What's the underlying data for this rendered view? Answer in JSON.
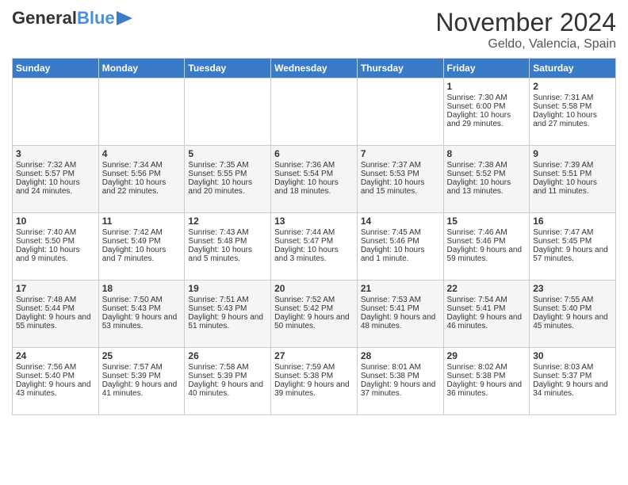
{
  "header": {
    "logo_line1": "General",
    "logo_line2": "Blue",
    "month_title": "November 2024",
    "location": "Geldo, Valencia, Spain"
  },
  "weekdays": [
    "Sunday",
    "Monday",
    "Tuesday",
    "Wednesday",
    "Thursday",
    "Friday",
    "Saturday"
  ],
  "weeks": [
    [
      {
        "day": "",
        "sunrise": "",
        "sunset": "",
        "daylight": ""
      },
      {
        "day": "",
        "sunrise": "",
        "sunset": "",
        "daylight": ""
      },
      {
        "day": "",
        "sunrise": "",
        "sunset": "",
        "daylight": ""
      },
      {
        "day": "",
        "sunrise": "",
        "sunset": "",
        "daylight": ""
      },
      {
        "day": "",
        "sunrise": "",
        "sunset": "",
        "daylight": ""
      },
      {
        "day": "1",
        "sunrise": "Sunrise: 7:30 AM",
        "sunset": "Sunset: 6:00 PM",
        "daylight": "Daylight: 10 hours and 29 minutes."
      },
      {
        "day": "2",
        "sunrise": "Sunrise: 7:31 AM",
        "sunset": "Sunset: 5:58 PM",
        "daylight": "Daylight: 10 hours and 27 minutes."
      }
    ],
    [
      {
        "day": "3",
        "sunrise": "Sunrise: 7:32 AM",
        "sunset": "Sunset: 5:57 PM",
        "daylight": "Daylight: 10 hours and 24 minutes."
      },
      {
        "day": "4",
        "sunrise": "Sunrise: 7:34 AM",
        "sunset": "Sunset: 5:56 PM",
        "daylight": "Daylight: 10 hours and 22 minutes."
      },
      {
        "day": "5",
        "sunrise": "Sunrise: 7:35 AM",
        "sunset": "Sunset: 5:55 PM",
        "daylight": "Daylight: 10 hours and 20 minutes."
      },
      {
        "day": "6",
        "sunrise": "Sunrise: 7:36 AM",
        "sunset": "Sunset: 5:54 PM",
        "daylight": "Daylight: 10 hours and 18 minutes."
      },
      {
        "day": "7",
        "sunrise": "Sunrise: 7:37 AM",
        "sunset": "Sunset: 5:53 PM",
        "daylight": "Daylight: 10 hours and 15 minutes."
      },
      {
        "day": "8",
        "sunrise": "Sunrise: 7:38 AM",
        "sunset": "Sunset: 5:52 PM",
        "daylight": "Daylight: 10 hours and 13 minutes."
      },
      {
        "day": "9",
        "sunrise": "Sunrise: 7:39 AM",
        "sunset": "Sunset: 5:51 PM",
        "daylight": "Daylight: 10 hours and 11 minutes."
      }
    ],
    [
      {
        "day": "10",
        "sunrise": "Sunrise: 7:40 AM",
        "sunset": "Sunset: 5:50 PM",
        "daylight": "Daylight: 10 hours and 9 minutes."
      },
      {
        "day": "11",
        "sunrise": "Sunrise: 7:42 AM",
        "sunset": "Sunset: 5:49 PM",
        "daylight": "Daylight: 10 hours and 7 minutes."
      },
      {
        "day": "12",
        "sunrise": "Sunrise: 7:43 AM",
        "sunset": "Sunset: 5:48 PM",
        "daylight": "Daylight: 10 hours and 5 minutes."
      },
      {
        "day": "13",
        "sunrise": "Sunrise: 7:44 AM",
        "sunset": "Sunset: 5:47 PM",
        "daylight": "Daylight: 10 hours and 3 minutes."
      },
      {
        "day": "14",
        "sunrise": "Sunrise: 7:45 AM",
        "sunset": "Sunset: 5:46 PM",
        "daylight": "Daylight: 10 hours and 1 minute."
      },
      {
        "day": "15",
        "sunrise": "Sunrise: 7:46 AM",
        "sunset": "Sunset: 5:46 PM",
        "daylight": "Daylight: 9 hours and 59 minutes."
      },
      {
        "day": "16",
        "sunrise": "Sunrise: 7:47 AM",
        "sunset": "Sunset: 5:45 PM",
        "daylight": "Daylight: 9 hours and 57 minutes."
      }
    ],
    [
      {
        "day": "17",
        "sunrise": "Sunrise: 7:48 AM",
        "sunset": "Sunset: 5:44 PM",
        "daylight": "Daylight: 9 hours and 55 minutes."
      },
      {
        "day": "18",
        "sunrise": "Sunrise: 7:50 AM",
        "sunset": "Sunset: 5:43 PM",
        "daylight": "Daylight: 9 hours and 53 minutes."
      },
      {
        "day": "19",
        "sunrise": "Sunrise: 7:51 AM",
        "sunset": "Sunset: 5:43 PM",
        "daylight": "Daylight: 9 hours and 51 minutes."
      },
      {
        "day": "20",
        "sunrise": "Sunrise: 7:52 AM",
        "sunset": "Sunset: 5:42 PM",
        "daylight": "Daylight: 9 hours and 50 minutes."
      },
      {
        "day": "21",
        "sunrise": "Sunrise: 7:53 AM",
        "sunset": "Sunset: 5:41 PM",
        "daylight": "Daylight: 9 hours and 48 minutes."
      },
      {
        "day": "22",
        "sunrise": "Sunrise: 7:54 AM",
        "sunset": "Sunset: 5:41 PM",
        "daylight": "Daylight: 9 hours and 46 minutes."
      },
      {
        "day": "23",
        "sunrise": "Sunrise: 7:55 AM",
        "sunset": "Sunset: 5:40 PM",
        "daylight": "Daylight: 9 hours and 45 minutes."
      }
    ],
    [
      {
        "day": "24",
        "sunrise": "Sunrise: 7:56 AM",
        "sunset": "Sunset: 5:40 PM",
        "daylight": "Daylight: 9 hours and 43 minutes."
      },
      {
        "day": "25",
        "sunrise": "Sunrise: 7:57 AM",
        "sunset": "Sunset: 5:39 PM",
        "daylight": "Daylight: 9 hours and 41 minutes."
      },
      {
        "day": "26",
        "sunrise": "Sunrise: 7:58 AM",
        "sunset": "Sunset: 5:39 PM",
        "daylight": "Daylight: 9 hours and 40 minutes."
      },
      {
        "day": "27",
        "sunrise": "Sunrise: 7:59 AM",
        "sunset": "Sunset: 5:38 PM",
        "daylight": "Daylight: 9 hours and 39 minutes."
      },
      {
        "day": "28",
        "sunrise": "Sunrise: 8:01 AM",
        "sunset": "Sunset: 5:38 PM",
        "daylight": "Daylight: 9 hours and 37 minutes."
      },
      {
        "day": "29",
        "sunrise": "Sunrise: 8:02 AM",
        "sunset": "Sunset: 5:38 PM",
        "daylight": "Daylight: 9 hours and 36 minutes."
      },
      {
        "day": "30",
        "sunrise": "Sunrise: 8:03 AM",
        "sunset": "Sunset: 5:37 PM",
        "daylight": "Daylight: 9 hours and 34 minutes."
      }
    ]
  ]
}
